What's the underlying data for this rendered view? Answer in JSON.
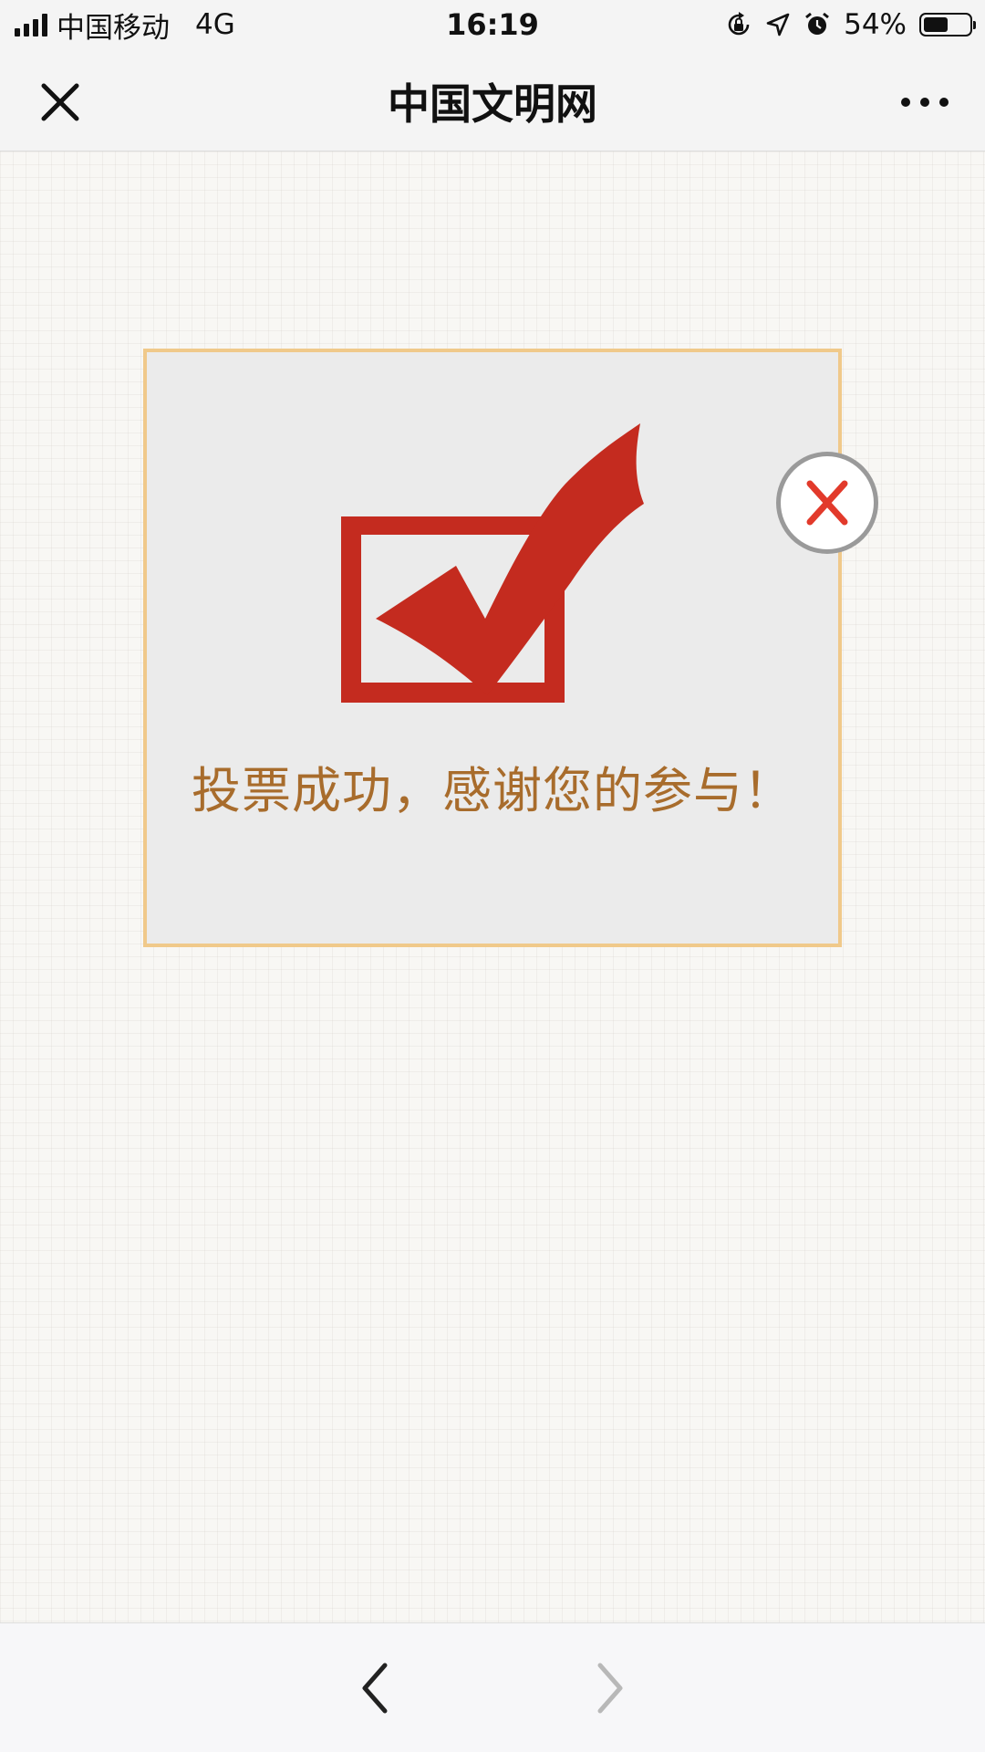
{
  "status_bar": {
    "carrier": "中国移动",
    "network": "4G",
    "time": "16:19",
    "battery_percent": "54%",
    "battery_level": 0.54,
    "icons": [
      "signal-icon",
      "orientation-lock-icon",
      "location-arrow-icon",
      "alarm-icon",
      "battery-icon"
    ]
  },
  "nav": {
    "title": "中国文明网",
    "icons": [
      "close-icon",
      "more-icon"
    ]
  },
  "dialog": {
    "message": "投票成功，感谢您的参与！",
    "icons": [
      "checkbox-check-icon",
      "dialog-close-icon"
    ],
    "colors": {
      "check": "#c42b1f",
      "message": "#a86c2c",
      "border": "#f0c98a",
      "close_x": "#e23a2b"
    }
  },
  "toolbar": {
    "icons": [
      "back-arrow-icon",
      "forward-arrow-icon"
    ],
    "back_enabled": true,
    "forward_enabled": false
  }
}
